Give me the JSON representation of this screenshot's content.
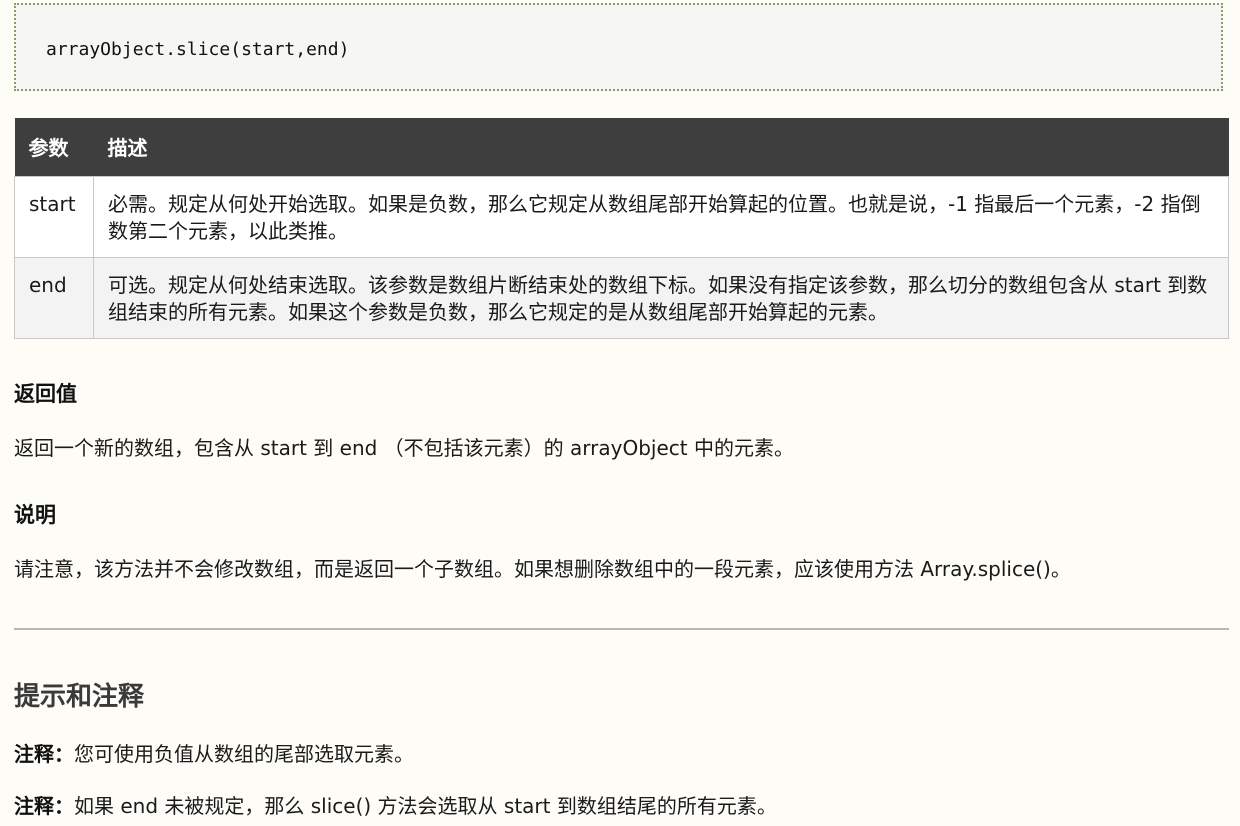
{
  "code": {
    "syntax": "arrayObject.slice(start,end)"
  },
  "table": {
    "headers": [
      "参数",
      "描述"
    ],
    "rows": [
      {
        "param": "start",
        "description": "必需。规定从何处开始选取。如果是负数，那么它规定从数组尾部开始算起的位置。也就是说，-1 指最后一个元素，-2 指倒数第二个元素，以此类推。"
      },
      {
        "param": "end",
        "description": "可选。规定从何处结束选取。该参数是数组片断结束处的数组下标。如果没有指定该参数，那么切分的数组包含从 start 到数组结束的所有元素。如果这个参数是负数，那么它规定的是从数组尾部开始算起的元素。"
      }
    ]
  },
  "return_value": {
    "heading": "返回值",
    "text": "返回一个新的数组，包含从 start 到 end （不包括该元素）的 arrayObject 中的元素。"
  },
  "description": {
    "heading": "说明",
    "text": "请注意，该方法并不会修改数组，而是返回一个子数组。如果想删除数组中的一段元素，应该使用方法 Array.splice()。"
  },
  "tips": {
    "heading": "提示和注释",
    "notes": [
      {
        "label": "注释：",
        "text": "您可使用负值从数组的尾部选取元素。"
      },
      {
        "label": "注释：",
        "text": "如果 end 未被规定，那么 slice() 方法会选取从 start 到数组结尾的所有元素。"
      }
    ]
  }
}
